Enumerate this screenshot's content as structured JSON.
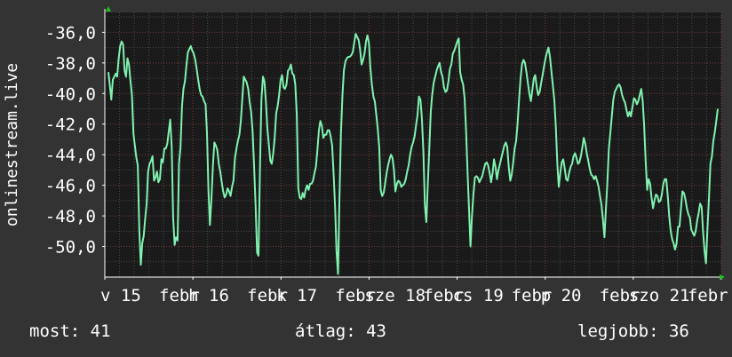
{
  "chart_data": {
    "type": "line",
    "ylabel": "onlinestream.live",
    "ylim": [
      -52.0,
      -34.7
    ],
    "yticks": [
      -50,
      -48,
      -46,
      -44,
      -42,
      -40,
      -38,
      -36
    ],
    "ytick_labels": [
      "-50,0",
      "-48,0",
      "-46,0",
      "-44,0",
      "-42,0",
      "-40,0",
      "-38,0",
      "-36,0"
    ],
    "x_labels": [
      "v 15",
      "febr",
      "h 16",
      "febr",
      "k 17",
      "febr",
      "sze 18",
      "febr",
      "cs 19",
      "febr",
      "p 20",
      "febr",
      "szo 21",
      "febr"
    ],
    "grid": true,
    "colors": {
      "background": "#333333",
      "plot": "#1a1a1a",
      "line": "#80f2b0",
      "axis": "#ffffff",
      "grid_major": "#7a3a3a",
      "grid_minor": "#4a4a4a",
      "arrow": "#20c020"
    },
    "series": [
      {
        "values": [
          -38.6,
          -39.5,
          -40.4,
          -39.1,
          -38.9,
          -38.7,
          -38.9,
          -37.7,
          -36.9,
          -36.6,
          -36.8,
          -38.5,
          -38.9,
          -37.7,
          -38.1,
          -39.2,
          -40.1,
          -42.6,
          -43.4,
          -44.2,
          -44.7,
          -48.9,
          -51.2,
          -49.8,
          -49.3,
          -48.2,
          -47.2,
          -45.1,
          -44.6,
          -44.4,
          -44.1,
          -45.7,
          -45.5,
          -45.1,
          -45.8,
          -45.6,
          -44.3,
          -44.5,
          -43.6,
          -43.6,
          -43.3,
          -42.5,
          -41.7,
          -43.5,
          -48.1,
          -49.9,
          -49.4,
          -49.6,
          -44.6,
          -43.5,
          -40.8,
          -39.7,
          -39.2,
          -38.2,
          -37.3,
          -37.1,
          -36.9,
          -37.2,
          -37.4,
          -37.8,
          -38.4,
          -39.1,
          -39.7,
          -40.1,
          -40.2,
          -40.5,
          -40.7,
          -42.6,
          -46.4,
          -48.6,
          -46.9,
          -44.8,
          -43.2,
          -43.4,
          -43.7,
          -44.6,
          -45.1,
          -45.8,
          -46.4,
          -46.8,
          -46.6,
          -46.2,
          -46.4,
          -46.7,
          -46.1,
          -45.7,
          -44.2,
          -43.6,
          -43.1,
          -42.7,
          -41.8,
          -40.3,
          -38.9,
          -39.1,
          -39.3,
          -39.7,
          -40.6,
          -41.2,
          -42.5,
          -44.7,
          -47.3,
          -50.4,
          -50.6,
          -44.7,
          -40.4,
          -38.9,
          -39.2,
          -40.5,
          -42.3,
          -43.3,
          -44.4,
          -44.6,
          -43.9,
          -42.9,
          -41.3,
          -40.8,
          -40.1,
          -39.1,
          -38.8,
          -39.6,
          -39.7,
          -39.4,
          -38.5,
          -38.4,
          -38.1,
          -38.7,
          -38.8,
          -39.4,
          -41.4,
          -46.2,
          -46.8,
          -46.9,
          -46.5,
          -46.8,
          -46.3,
          -46.0,
          -46.3,
          -45.9,
          -45.9,
          -45.7,
          -45.2,
          -44.8,
          -43.7,
          -42.4,
          -41.8,
          -42.1,
          -42.9,
          -42.7,
          -42.7,
          -42.4,
          -42.4,
          -42.8,
          -43.4,
          -45.2,
          -47.4,
          -50.3,
          -51.8,
          -46.9,
          -42.6,
          -40.1,
          -38.5,
          -37.9,
          -37.7,
          -37.6,
          -37.6,
          -37.5,
          -37.3,
          -36.7,
          -36.1,
          -36.3,
          -36.5,
          -37.1,
          -38.1,
          -37.8,
          -37.4,
          -36.6,
          -36.2,
          -36.7,
          -38.3,
          -39.4,
          -40.2,
          -40.5,
          -41.4,
          -42.3,
          -43.5,
          -46.3,
          -46.7,
          -46.5,
          -45.9,
          -45.2,
          -44.7,
          -44.3,
          -44.0,
          -44.2,
          -45.0,
          -46.4,
          -45.9,
          -45.7,
          -45.8,
          -46.1,
          -46.0,
          -45.9,
          -45.6,
          -45.1,
          -44.7,
          -44.0,
          -43.5,
          -43.2,
          -42.8,
          -42.1,
          -41.4,
          -40.2,
          -40.4,
          -41.6,
          -43.8,
          -47.3,
          -48.4,
          -45.9,
          -43.7,
          -41.2,
          -40.1,
          -39.3,
          -38.9,
          -38.5,
          -38.2,
          -38.0,
          -38.6,
          -38.9,
          -39.6,
          -39.9,
          -39.8,
          -39.2,
          -38.4,
          -38.1,
          -37.4,
          -37.2,
          -36.9,
          -36.6,
          -36.4,
          -38.6,
          -39.1,
          -39.4,
          -40.3,
          -42.5,
          -45.1,
          -47.6,
          -50.0,
          -48.0,
          -46.6,
          -45.5,
          -45.4,
          -45.5,
          -45.8,
          -45.6,
          -45.4,
          -45.0,
          -44.6,
          -44.5,
          -44.7,
          -45.2,
          -45.8,
          -45.2,
          -44.3,
          -44.8,
          -45.6,
          -45.0,
          -44.6,
          -44.2,
          -43.8,
          -43.4,
          -43.2,
          -43.5,
          -44.8,
          -45.7,
          -45.3,
          -44.5,
          -43.6,
          -43.1,
          -42.0,
          -40.4,
          -39.0,
          -38.1,
          -37.8,
          -38.0,
          -38.6,
          -39.3,
          -40.0,
          -40.5,
          -39.8,
          -39.0,
          -38.8,
          -39.6,
          -40.1,
          -39.9,
          -39.3,
          -38.8,
          -38.2,
          -37.7,
          -37.3,
          -37.0,
          -37.6,
          -38.6,
          -39.5,
          -40.5,
          -42.2,
          -44.6,
          -46.1,
          -45.2,
          -44.5,
          -44.3,
          -44.9,
          -45.6,
          -45.7,
          -45.2,
          -44.8,
          -44.6,
          -44.1,
          -43.9,
          -44.2,
          -44.6,
          -44.5,
          -44.1,
          -43.5,
          -42.9,
          -43.3,
          -43.9,
          -44.4,
          -44.9,
          -45.3,
          -45.4,
          -45.6,
          -45.4,
          -45.7,
          -46.1,
          -46.7,
          -47.3,
          -48.3,
          -49.4,
          -47.5,
          -45.8,
          -43.6,
          -42.6,
          -41.5,
          -40.4,
          -39.9,
          -39.7,
          -39.5,
          -39.4,
          -39.6,
          -40.1,
          -40.4,
          -40.6,
          -41.1,
          -41.5,
          -41.2,
          -41.5,
          -40.9,
          -40.3,
          -40.4,
          -40.7,
          -40.5,
          -40.1,
          -39.7,
          -40.5,
          -42.1,
          -44.4,
          -46.3,
          -45.6,
          -45.9,
          -46.8,
          -47.5,
          -47.0,
          -46.6,
          -46.7,
          -47.1,
          -47.0,
          -46.6,
          -45.9,
          -45.6,
          -45.6,
          -46.7,
          -48.0,
          -49.0,
          -49.5,
          -49.8,
          -50.2,
          -49.8,
          -48.7,
          -48.7,
          -47.5,
          -46.4,
          -46.5,
          -46.9,
          -47.5,
          -47.9,
          -48.1,
          -48.9,
          -49.1,
          -49.3,
          -49.0,
          -48.3,
          -47.8,
          -47.2,
          -47.4,
          -49.0,
          -50.3,
          -51.1,
          -48.8,
          -46.8,
          -44.6,
          -44.1,
          -43.1,
          -42.5,
          -41.8,
          -41.0
        ]
      }
    ]
  },
  "stats": {
    "now_label": "most: 41",
    "avg_label": "átlag: 43",
    "best_label": "legjobb: 36"
  }
}
